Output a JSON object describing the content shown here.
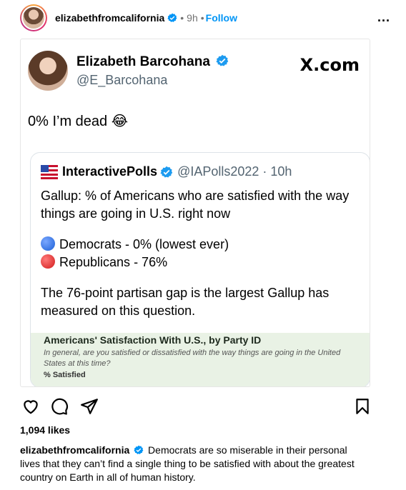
{
  "post": {
    "username": "elizabethfromcalifornia",
    "time": "9h",
    "follow_label": "Follow",
    "more_label": "...",
    "likes": "1,094 likes",
    "caption": "Democrats are so miserable in their personal lives that they can’t find a single thing to be satisfied with about the greatest country on Earth in all of human history."
  },
  "tweet": {
    "name": "Elizabeth Barcohana",
    "handle": "@E_Barcohana",
    "site": "X.com",
    "text": "0% I’m dead 😂"
  },
  "quote": {
    "name": "InteractivePolls",
    "handle": "@IAPolls2022 · 10h",
    "line1": "Gallup: % of Americans who are satisfied with the way things are going in U.S. right now",
    "dem": "Democrats - 0% (lowest ever)",
    "rep": "Republicans - 76%",
    "line2": "The 76-point partisan gap is the largest Gallup has measured on this question."
  },
  "gallup": {
    "title": "Americans' Satisfaction With U.S., by Party ID",
    "subtitle": "In general, are you satisfied or dissatisfied with the way things are going in the United States at this time?",
    "label": "% Satisfied"
  },
  "colors": {
    "link": "#0095f6",
    "verified": "#0095f6"
  },
  "icons": [
    "heart-icon",
    "comment-icon",
    "share-icon",
    "bookmark-icon",
    "verified-icon",
    "flag-icon"
  ]
}
